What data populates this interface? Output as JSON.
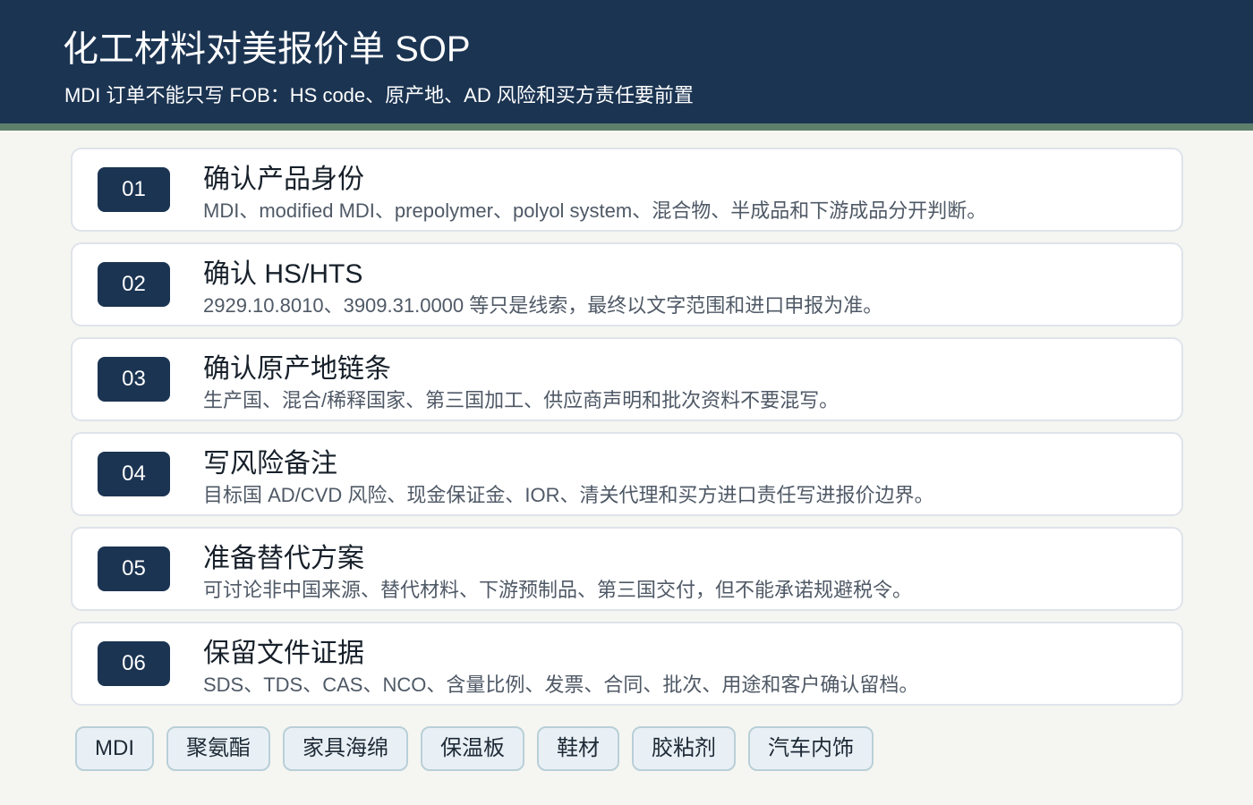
{
  "header": {
    "title": "化工材料对美报价单 SOP",
    "subtitle": "MDI 订单不能只写 FOB：HS code、原产地、AD 风险和买方责任要前置"
  },
  "steps": [
    {
      "number": "01",
      "title": "确认产品身份",
      "description": "MDI、modified MDI、prepolymer、polyol system、混合物、半成品和下游成品分开判断。"
    },
    {
      "number": "02",
      "title": "确认 HS/HTS",
      "description": "2929.10.8010、3909.31.0000 等只是线索，最终以文字范围和进口申报为准。"
    },
    {
      "number": "03",
      "title": "确认原产地链条",
      "description": "生产国、混合/稀释国家、第三国加工、供应商声明和批次资料不要混写。"
    },
    {
      "number": "04",
      "title": "写风险备注",
      "description": "目标国 AD/CVD 风险、现金保证金、IOR、清关代理和买方进口责任写进报价边界。"
    },
    {
      "number": "05",
      "title": "准备替代方案",
      "description": "可讨论非中国来源、替代材料、下游预制品、第三国交付，但不能承诺规避税令。"
    },
    {
      "number": "06",
      "title": "保留文件证据",
      "description": "SDS、TDS、CAS、NCO、含量比例、发票、合同、批次、用途和客户确认留档。"
    }
  ],
  "tags": [
    "MDI",
    "聚氨酯",
    "家具海绵",
    "保温板",
    "鞋材",
    "胶粘剂",
    "汽车内饰"
  ],
  "colors": {
    "header_bg": "#1b3452",
    "accent": "#5f7f6d",
    "badge_bg": "#1b3452",
    "page_bg": "#f5f6f1",
    "tag_bg": "#e9f0f5",
    "tag_border": "#b9cfd8"
  }
}
